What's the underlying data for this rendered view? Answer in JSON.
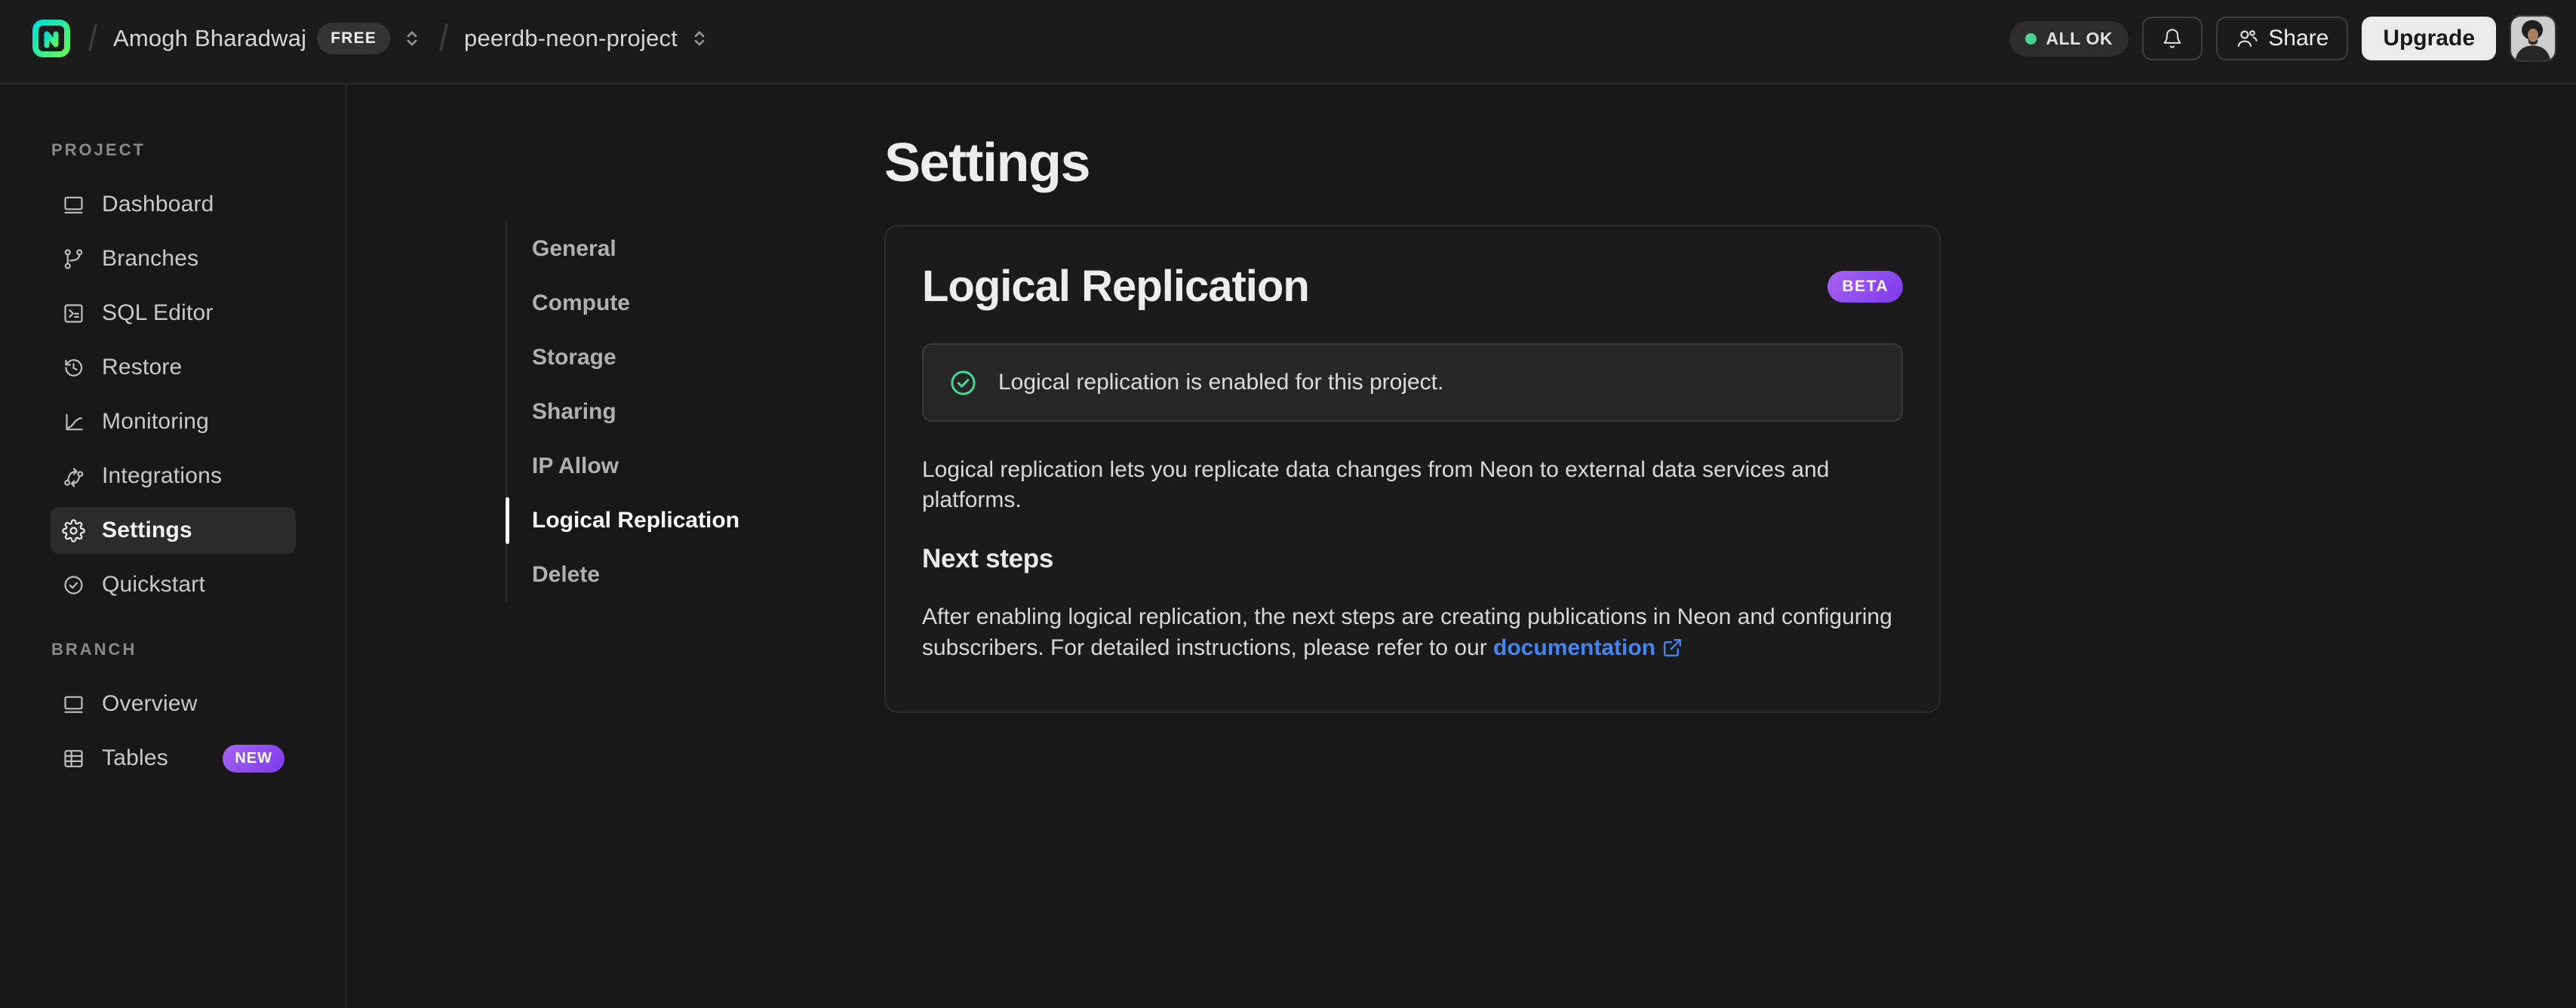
{
  "topbar": {
    "separator": "/",
    "org_name": "Amogh Bharadwaj",
    "org_plan_badge": "FREE",
    "project_name": "peerdb-neon-project",
    "status_pill": "ALL OK",
    "share_label": "Share",
    "upgrade_label": "Upgrade"
  },
  "sidebar": {
    "sections": [
      {
        "label": "PROJECT",
        "items": [
          {
            "label": "Dashboard",
            "icon": "dashboard-icon",
            "active": false
          },
          {
            "label": "Branches",
            "icon": "branches-icon",
            "active": false
          },
          {
            "label": "SQL Editor",
            "icon": "sql-editor-icon",
            "active": false
          },
          {
            "label": "Restore",
            "icon": "restore-icon",
            "active": false
          },
          {
            "label": "Monitoring",
            "icon": "monitoring-icon",
            "active": false
          },
          {
            "label": "Integrations",
            "icon": "integrations-icon",
            "active": false
          },
          {
            "label": "Settings",
            "icon": "settings-icon",
            "active": true
          },
          {
            "label": "Quickstart",
            "icon": "quickstart-icon",
            "active": false
          }
        ]
      },
      {
        "label": "BRANCH",
        "items": [
          {
            "label": "Overview",
            "icon": "overview-icon",
            "active": false
          },
          {
            "label": "Tables",
            "icon": "tables-icon",
            "active": false,
            "badge": "NEW"
          }
        ]
      }
    ]
  },
  "settings_nav": {
    "items": [
      {
        "label": "General",
        "active": false
      },
      {
        "label": "Compute",
        "active": false
      },
      {
        "label": "Storage",
        "active": false
      },
      {
        "label": "Sharing",
        "active": false
      },
      {
        "label": "IP Allow",
        "active": false
      },
      {
        "label": "Logical Replication",
        "active": true
      },
      {
        "label": "Delete",
        "active": false
      }
    ]
  },
  "main": {
    "page_title": "Settings",
    "card": {
      "title": "Logical Replication",
      "badge": "BETA",
      "alert_text": "Logical replication is enabled for this project.",
      "description": "Logical replication lets you replicate data changes from Neon to external data services and platforms.",
      "next_steps_title": "Next steps",
      "next_steps_text": "After enabling logical replication, the next steps are creating publications in Neon and configuring subscribers. For detailed instructions, please refer to our ",
      "doc_link_label": "documentation"
    }
  },
  "colors": {
    "topbar_bg": "#1b1b1b",
    "page_bg": "#181818",
    "border": "#292929",
    "status_dot_green": "#4ed294",
    "success_green": "#43dc96",
    "badge_purple_start": "#a863f1",
    "badge_purple_end": "#7c3aed",
    "link_blue": "#4285f5",
    "logo_gradient_start": "#00e0d9",
    "logo_gradient_end": "#63f655"
  }
}
